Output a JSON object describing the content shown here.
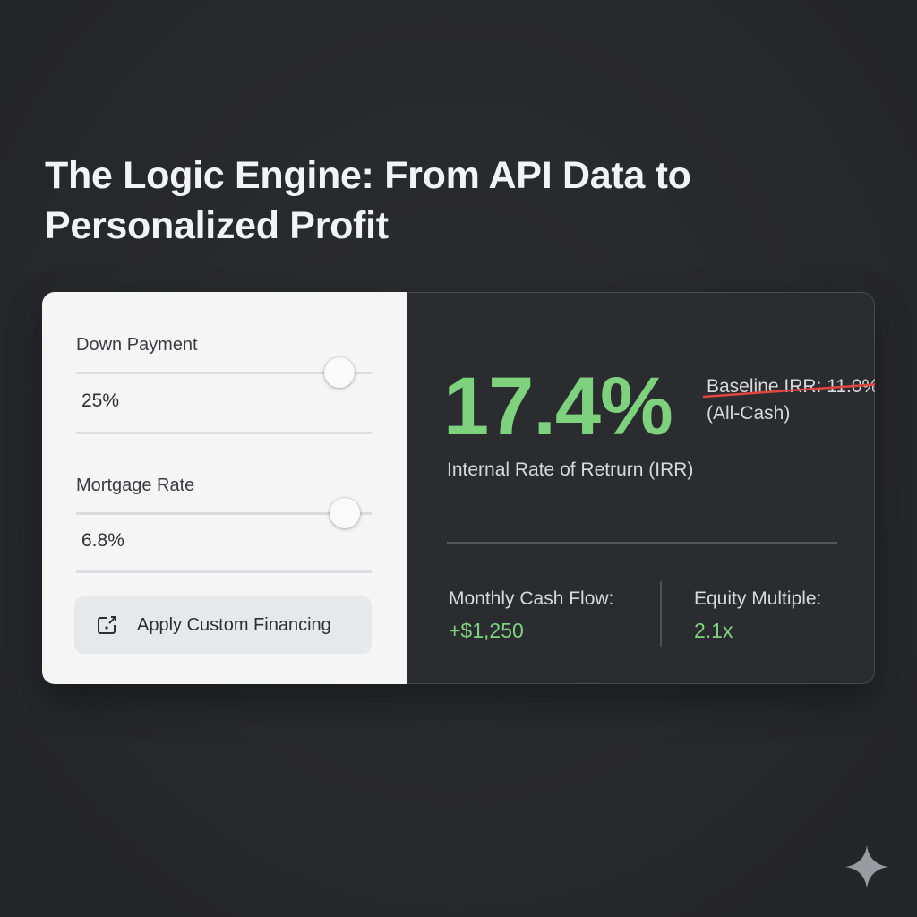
{
  "title": "The Logic Engine: From API Data to Personalized Profit",
  "controls": {
    "down_payment": {
      "label": "Down Payment",
      "value": "25%",
      "slider_level": 0.89
    },
    "mortgage_rate": {
      "label": "Mortgage Rate",
      "value": "6.8%",
      "slider_level": 0.91
    },
    "apply_button": {
      "label": "Apply Custom Financing",
      "icon": "apply-financing-icon"
    }
  },
  "results": {
    "irr_value": "17.4%",
    "irr_label": "Internal Rate of Retrurn (IRR)",
    "baseline_line1": "Baseline IRR: 11.0%",
    "baseline_line2": "(All-Cash)",
    "cash_flow_label": "Monthly Cash Flow:",
    "cash_flow_value": "+$1,250",
    "equity_label": "Equity Multiple:",
    "equity_value": "2.1x"
  },
  "colors": {
    "accent_green": "#7ed27e",
    "strike_red": "#e0463f",
    "background": "#292a2d",
    "panel_light": "#f5f5f5",
    "panel_dark": "#2b2c30"
  },
  "icons": {
    "watermark": "sparkle-icon"
  }
}
